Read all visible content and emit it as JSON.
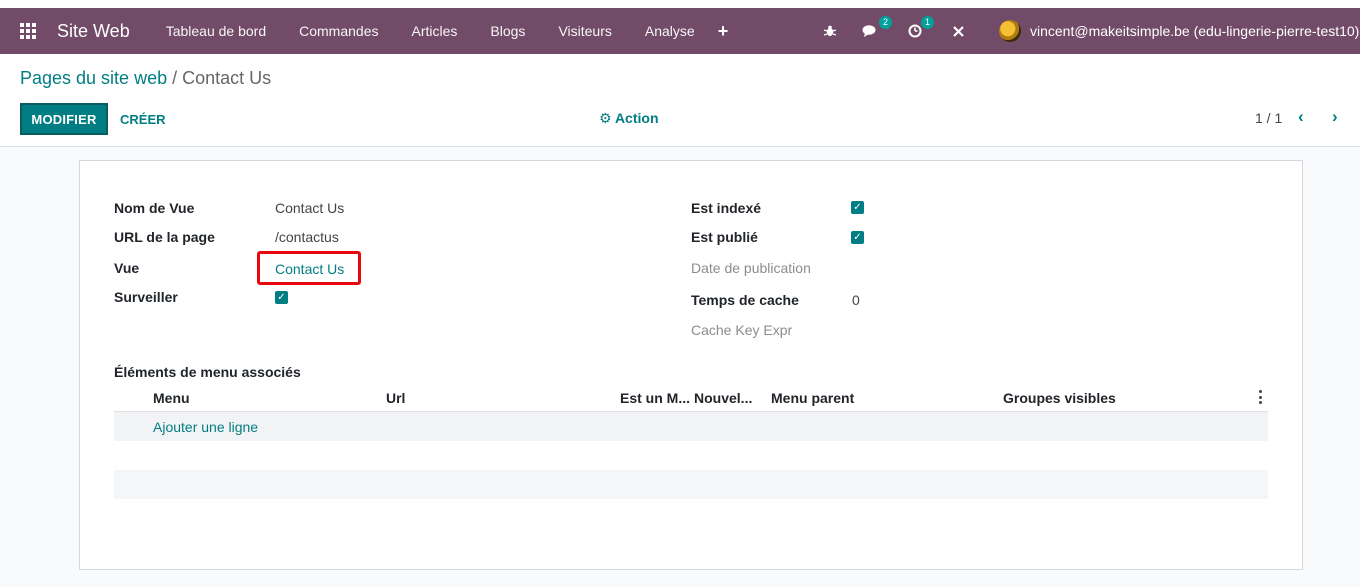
{
  "navbar": {
    "brand": "Site Web",
    "items": [
      "Tableau de bord",
      "Commandes",
      "Articles",
      "Blogs",
      "Visiteurs",
      "Analyse"
    ],
    "plus": "+",
    "messages_count": "2",
    "activities_count": "1",
    "user": "vincent@makeitsimple.be (edu-lingerie-pierre-test10)",
    "color": "#714B67"
  },
  "breadcrumb": {
    "parent": "Pages du site web",
    "separator": "/",
    "current": "Contact Us"
  },
  "buttons": {
    "edit": "MODIFIER",
    "create": "CRÉER",
    "action": "Action"
  },
  "pager": {
    "value": "1 / 1"
  },
  "form": {
    "left": {
      "view_name_label": "Nom de Vue",
      "view_name_value": "Contact Us",
      "url_label": "URL de la page",
      "url_value": "/contactus",
      "view_label": "Vue",
      "view_value": "Contact Us",
      "track_label": "Surveiller",
      "track_checked": true
    },
    "right": {
      "indexed_label": "Est indexé",
      "indexed_checked": true,
      "published_label": "Est publié",
      "published_checked": true,
      "date_label": "Date de publication",
      "cache_time_label": "Temps de cache",
      "cache_time_value": "0",
      "cache_key_label": "Cache Key Expr"
    }
  },
  "menu_table": {
    "title": "Éléments de menu associés",
    "columns": [
      "Menu",
      "Url",
      "Est un M...",
      "Nouvel...",
      "Menu parent",
      "Groupes visibles"
    ],
    "add_line": "Ajouter une ligne"
  },
  "colors": {
    "accent": "#017e84",
    "highlight": "#e8070b"
  }
}
